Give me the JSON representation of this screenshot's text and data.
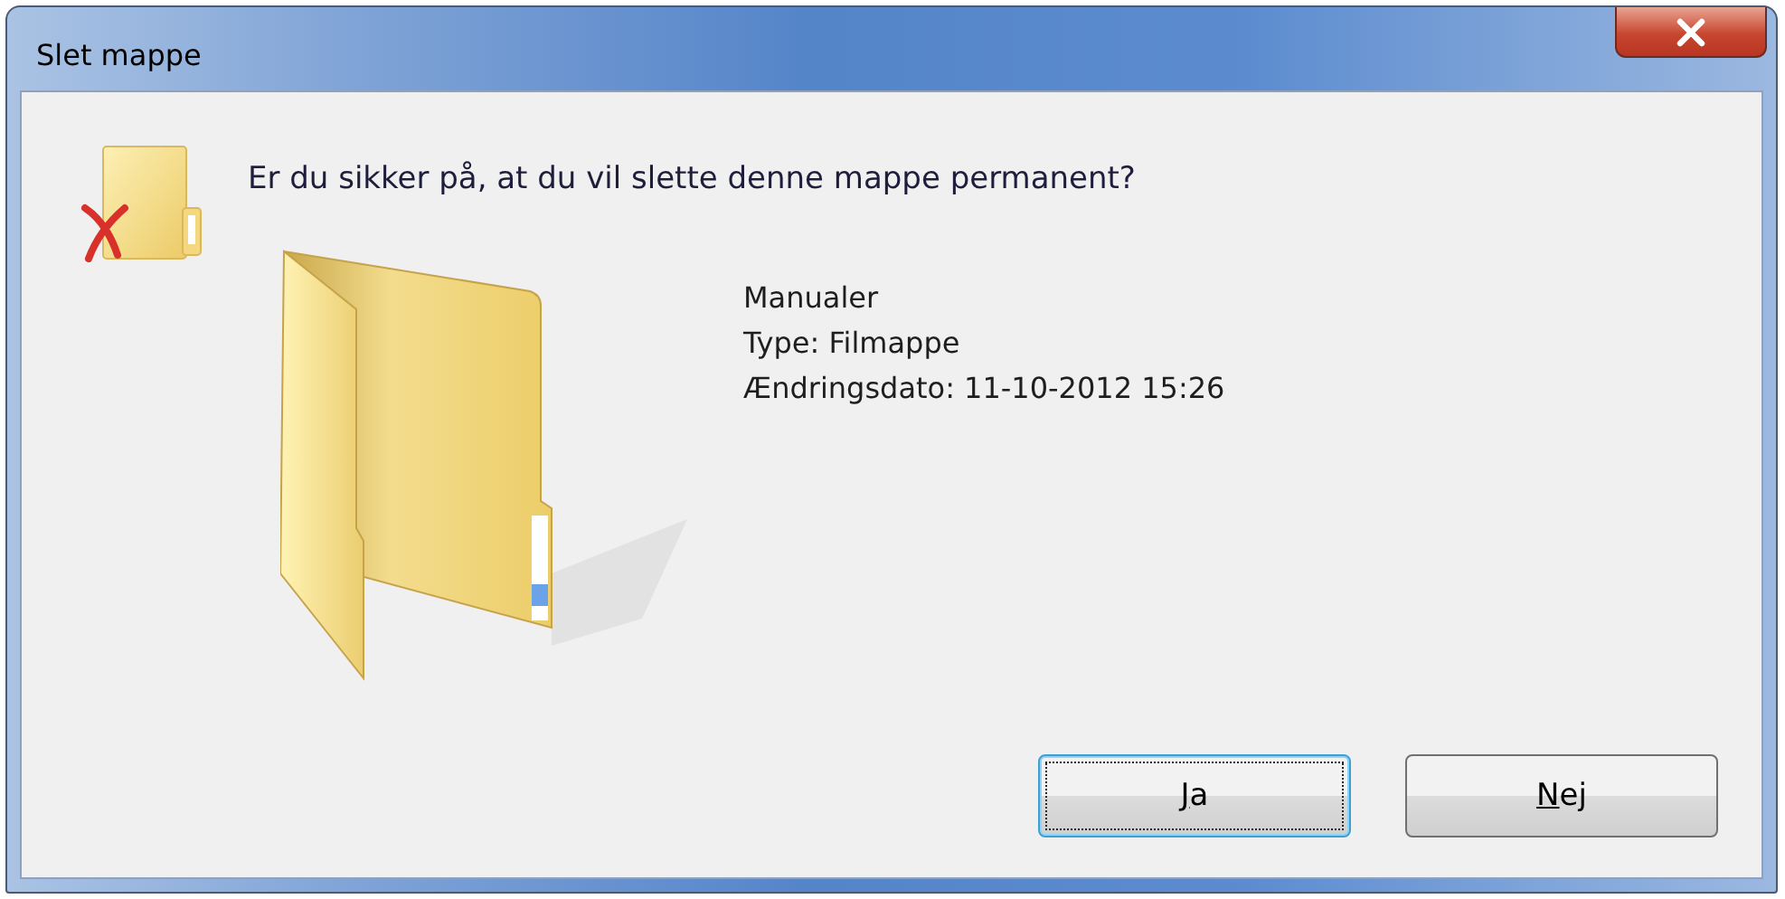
{
  "window": {
    "title": "Slet mappe"
  },
  "message": "Er du sikker på, at du vil slette denne mappe permanent?",
  "item": {
    "name": "Manualer",
    "type": "Type: Filmappe",
    "modified": "Ændringsdato: 11-10-2012 15:26"
  },
  "buttons": [
    {
      "label": "Ja",
      "focused": true
    },
    {
      "label": "Nej",
      "focused": false
    }
  ]
}
